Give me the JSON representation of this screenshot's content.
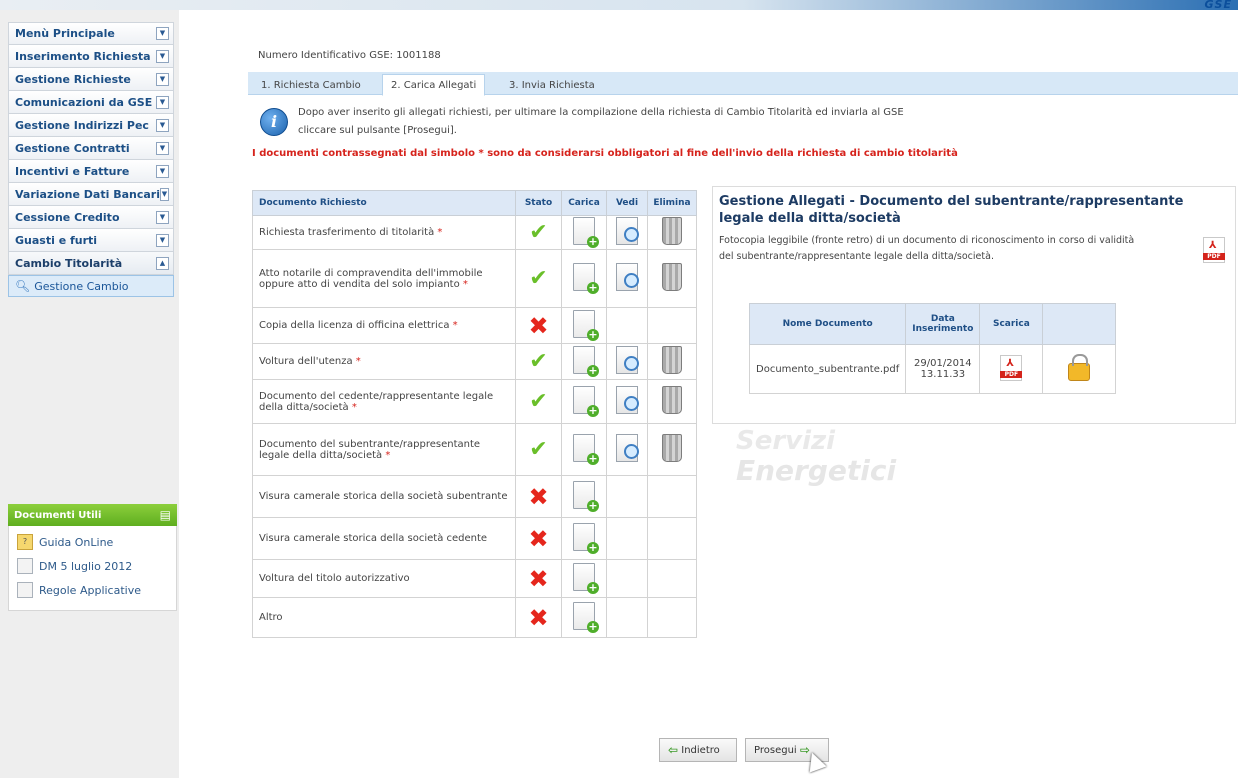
{
  "header": {
    "brand_fragment": "GSE"
  },
  "sidebar": {
    "menu": [
      {
        "label": "Menù Principale",
        "state": "collapsed"
      },
      {
        "label": "Inserimento Richiesta",
        "state": "collapsed"
      },
      {
        "label": "Gestione Richieste",
        "state": "collapsed"
      },
      {
        "label": "Comunicazioni da GSE",
        "state": "collapsed"
      },
      {
        "label": "Gestione Indirizzi Pec",
        "state": "collapsed"
      },
      {
        "label": "Gestione Contratti",
        "state": "collapsed"
      },
      {
        "label": "Incentivi e Fatture",
        "state": "collapsed"
      },
      {
        "label": "Variazione Dati Bancari",
        "state": "collapsed"
      },
      {
        "label": "Cessione Credito",
        "state": "collapsed"
      },
      {
        "label": "Guasti e furti",
        "state": "collapsed"
      },
      {
        "label": "Cambio Titolarità",
        "state": "expanded"
      }
    ],
    "submenu": [
      {
        "label": "Gestione Cambio"
      }
    ],
    "documents": {
      "title": "Documenti Utili",
      "links": [
        {
          "label": "Guida OnLine",
          "icon": "help-doc-icon"
        },
        {
          "label": "DM 5 luglio 2012",
          "icon": "document-icon"
        },
        {
          "label": "Regole Applicative",
          "icon": "document-icon"
        }
      ]
    }
  },
  "main": {
    "id_line": "Numero Identificativo GSE: 1001188",
    "tabs": [
      {
        "label": "1. Richiesta Cambio",
        "active": false
      },
      {
        "label": "2. Carica Allegati",
        "active": true
      },
      {
        "label": "3. Invia Richiesta",
        "active": false
      }
    ],
    "info_line1": "Dopo aver inserito gli allegati richiesti, per ultimare la compilazione della richiesta di Cambio Titolarità ed inviarla al GSE",
    "info_line2": "cliccare sul pulsante [Prosegui].",
    "warning": "I documenti contrassegnati dal simbolo * sono da considerarsi obbligatori al fine dell'invio della richiesta di cambio titolarità",
    "table": {
      "headers": [
        "Documento Richiesto",
        "Stato",
        "Carica",
        "Vedi",
        "Elimina"
      ],
      "rows": [
        {
          "name": "Richiesta trasferimento di titolarità",
          "required": "*",
          "status": "ok",
          "view": true,
          "delete": true
        },
        {
          "name": "Atto notarile di compravendita dell'immobile oppure atto di vendita del solo impianto",
          "required": "*",
          "status": "ok",
          "view": true,
          "delete": true
        },
        {
          "name": "Copia della licenza di officina elettrica",
          "required": "*",
          "status": "missing",
          "view": false,
          "delete": false
        },
        {
          "name": "Voltura dell'utenza",
          "required": "*",
          "status": "ok",
          "view": true,
          "delete": true
        },
        {
          "name": "Documento del cedente/rappresentante legale della ditta/società",
          "required": "*",
          "status": "ok",
          "view": true,
          "delete": true
        },
        {
          "name": "Documento del subentrante/rappresentante legale della ditta/società",
          "required": "*",
          "status": "ok",
          "view": true,
          "delete": true
        },
        {
          "name": "Visura camerale storica della società subentrante",
          "required": "",
          "status": "missing",
          "view": false,
          "delete": false
        },
        {
          "name": "Visura camerale storica della società cedente",
          "required": "",
          "status": "missing",
          "view": false,
          "delete": false
        },
        {
          "name": "Voltura del titolo autorizzativo",
          "required": "",
          "status": "missing",
          "view": false,
          "delete": false
        },
        {
          "name": "Altro",
          "required": "",
          "status": "missing",
          "view": false,
          "delete": false
        }
      ]
    },
    "panel": {
      "title": "Gestione Allegati - Documento del subentrante/rappresentante legale della ditta/società",
      "desc_line1": "Fotocopia leggibile (fronte retro) di un documento di riconoscimento in corso di validità",
      "desc_line2": "del subentrante/rappresentante legale della ditta/società.",
      "table": {
        "headers": [
          "Nome Documento",
          "Data Inserimento",
          "Scarica",
          ""
        ],
        "rows": [
          {
            "name": "Documento_subentrante.pdf",
            "date": "29/01/2014",
            "time": "13.11.33"
          }
        ]
      }
    },
    "watermark": [
      "Servizi",
      "Energetici"
    ],
    "buttons": {
      "back": "Indietro",
      "next": "Prosegui"
    }
  },
  "colors": {
    "accent": "#1c4f86",
    "warning": "#d6231c",
    "ok": "#6abf2a",
    "missing": "#e5261c",
    "docs_header": "#6cba28"
  }
}
